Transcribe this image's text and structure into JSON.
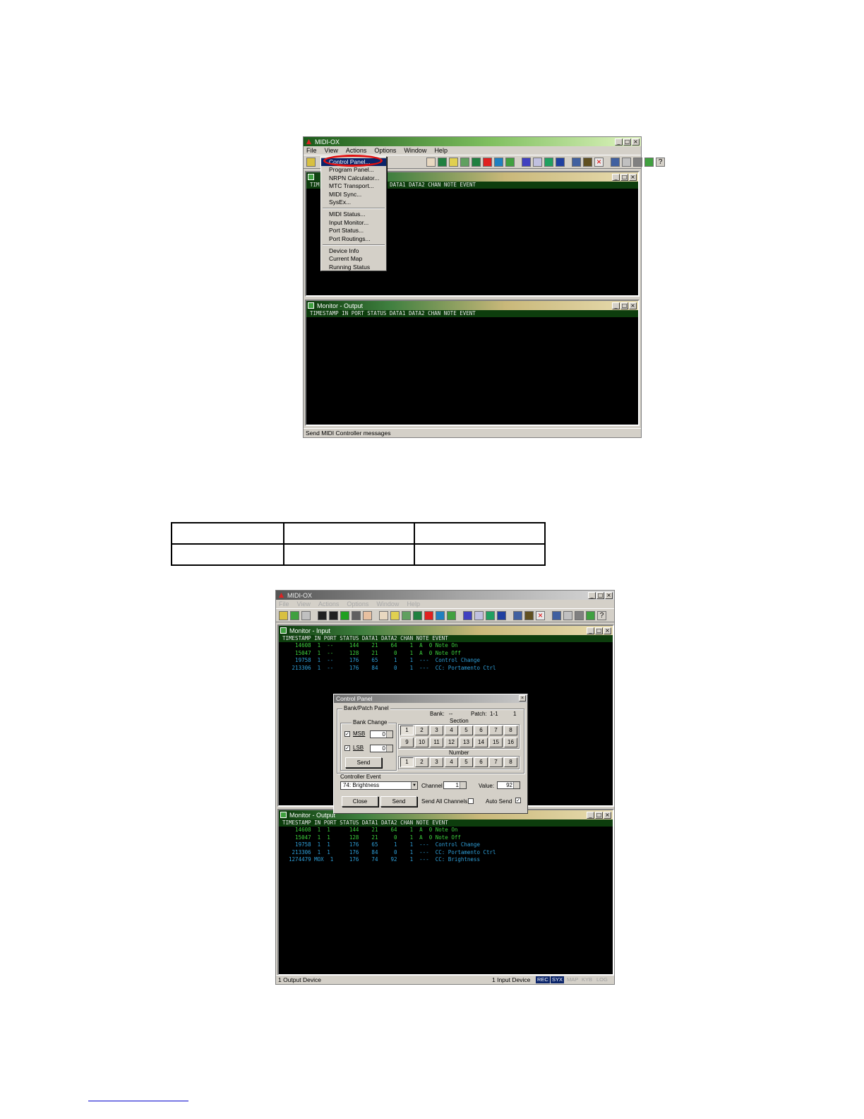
{
  "screen1": {
    "app_title": "MIDI-OX",
    "menus": [
      "File",
      "View",
      "Actions",
      "Options",
      "Window",
      "Help"
    ],
    "view_menu": {
      "group1": [
        "Control Panel...",
        "Program Panel...",
        "NRPN Calculator...",
        "MTC Transport...",
        "MIDI Sync...",
        "SysEx..."
      ],
      "group2": [
        "MIDI Status...",
        "Input Monitor...",
        "Port Status...",
        "Port Routings..."
      ],
      "group3": [
        "Device Info",
        "Current Map",
        "Running Status"
      ]
    },
    "input_monitor": {
      "header": "TIMESTAMP IN PORT STATUS DATA1 DATA2 CHAN NOTE EVENT",
      "visible_header_fragment": "US DATA1 DATA2 CHAN NOTE EVENT",
      "title_fragment": "TIM"
    },
    "output_monitor": {
      "title": "Monitor - Output",
      "header": "TIMESTAMP IN PORT STATUS DATA1 DATA2 CHAN NOTE EVENT"
    },
    "status_text": "Send MIDI Controller messages"
  },
  "table": {
    "rows": [
      [
        "",
        "",
        ""
      ],
      [
        "",
        "",
        ""
      ]
    ]
  },
  "screen2": {
    "app_title": "MIDI-OX",
    "menus": [
      "File",
      "View",
      "Actions",
      "Options",
      "Window",
      "Help"
    ],
    "input_monitor": {
      "title": "Monitor - Input",
      "header": "TIMESTAMP IN PORT STATUS DATA1 DATA2 CHAN NOTE EVENT",
      "rows": [
        {
          "text": "    14608  1  --     144    21    64    1  A  0 Note On",
          "color": "green"
        },
        {
          "text": "    15047  1  --     128    21     0    1  A  0 Note Off",
          "color": "green"
        },
        {
          "text": "    19758  1  --     176    65     1    1  ---  Control Change",
          "color": "blue"
        },
        {
          "text": "   213306  1  --     176    84     0    1  ---  CC: Portamento Ctrl",
          "color": "blue"
        }
      ]
    },
    "output_monitor": {
      "title": "Monitor - Output",
      "header": "TIMESTAMP IN PORT STATUS DATA1 DATA2 CHAN NOTE EVENT",
      "rows": [
        {
          "text": "    14608  1  1      144    21    64    1  A  0 Note On",
          "color": "green"
        },
        {
          "text": "    15047  1  1      128    21     0    1  A  0 Note Off",
          "color": "green"
        },
        {
          "text": "    19758  1  1      176    65     1    1  ---  Control Change",
          "color": "blue"
        },
        {
          "text": "   213306  1  1      176    84     0    1  ---  CC: Portamento Ctrl",
          "color": "blue"
        },
        {
          "text": "  1274479 MOX  1     176    74    92    1  ---  CC: Brightness",
          "color": "blue"
        }
      ]
    },
    "control_panel": {
      "title": "Control Panel",
      "bank_patch_label": "Bank/Patch Panel",
      "bank_label": "Bank:",
      "bank_value": "--",
      "patch_label": "Patch:",
      "patch_value": "1-1",
      "patch_num": "1",
      "bank_change_label": "Bank Change",
      "msb_label": "MSB",
      "msb_value": "0",
      "lsb_label": "LSB",
      "lsb_value": "0",
      "send_label_small": "Send",
      "section_label": "Section",
      "section_buttons": [
        "1",
        "2",
        "3",
        "4",
        "5",
        "6",
        "7",
        "8",
        "9",
        "10",
        "11",
        "12",
        "13",
        "14",
        "15",
        "16"
      ],
      "number_label": "Number",
      "number_buttons": [
        "1",
        "2",
        "3",
        "4",
        "5",
        "6",
        "7",
        "8"
      ],
      "controller_event_label": "Controller Event",
      "controller_value": "74: Brightness",
      "channel_label": "Channel",
      "channel_value": "1",
      "value_label": "Value:",
      "value_value": "92",
      "close_label": "Close",
      "send_label": "Send",
      "send_all_label": "Send All Channels",
      "auto_send_label": "Auto Send"
    },
    "status_left": "1 Output Device",
    "status_right": "1 Input Device",
    "badges": [
      "REC",
      "SYX",
      "MAP",
      "KYB",
      "LOG"
    ]
  }
}
